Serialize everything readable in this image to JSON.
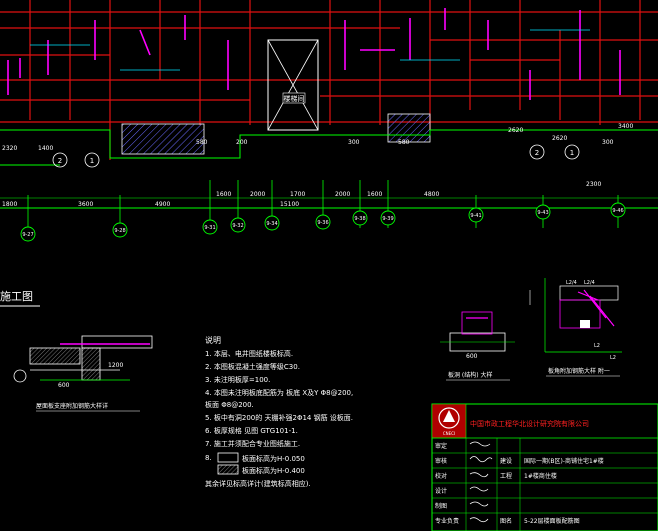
{
  "colors": {
    "background": "#000000",
    "wall": "#e01010",
    "axis": "#00ff00",
    "text": "#ffffff",
    "dim": "#00ff00",
    "rebar": "#ff00ff",
    "cyan": "#00e5ff",
    "hatch": "#4060ff",
    "yellow": "#ffff00"
  },
  "plan": {
    "stair_label": "楼梯间",
    "top_dim_labels": [
      "2320",
      "1400",
      "2620",
      "2620",
      "3400",
      "580",
      "200",
      "300",
      "580",
      "300"
    ],
    "axis_dims": [
      "1800",
      "3600",
      "4900",
      "1600",
      "2000",
      "15100",
      "1700",
      "2000",
      "1600",
      "4800",
      "2300"
    ],
    "axis_bubbles": [
      "9-27",
      "9-28",
      "9-31",
      "9-32",
      "9-34",
      "9-36",
      "9-38",
      "9-39",
      "9-41",
      "9-43",
      "9-46"
    ],
    "section_bubbles": [
      "2",
      "1",
      "2",
      "1"
    ]
  },
  "title_left": "施工图",
  "detail_left": {
    "caption": "屋面板支座附加钢筋大样详",
    "dims": [
      "600",
      "1200"
    ]
  },
  "notes": {
    "heading": "说明",
    "lines": [
      "1. 本层、电井图纸楼板标高.",
      "2. 本图板混凝土强度等级C30.",
      "3. 未注明板厚=100.",
      "4. 本图未注明板底配筋为 板底 X及Y  Φ8@200,",
      "   板面 Φ8@200.",
      "5. 板中有洞200的 天棚补强2Φ14 钢筋 设板面.",
      "6. 板厚规格 见图 GTG101-1.",
      "7. 施工并须配合专业图纸施工."
    ],
    "legend": [
      {
        "index": "8.",
        "label": "板面标高为H-0.050"
      },
      {
        "index": "",
        "label": "板面标高为H-0.400"
      }
    ],
    "footer": "其余详见标高详计(建筑标高相应)."
  },
  "detail_mid": {
    "caption": "板洞 (结构) 大样",
    "dim": "600"
  },
  "detail_right": {
    "labels": [
      "L2/4",
      "L2/4"
    ],
    "bottom": [
      "L2",
      "L2"
    ],
    "caption": "板角附加钢筋大样  附一"
  },
  "title_block": {
    "company": "中国市政工程华北设计研究院有限公司",
    "logo": "CNECI",
    "rows": [
      {
        "c1": "审定",
        "c2": "",
        "c3": "",
        "c4": ""
      },
      {
        "c1": "审核",
        "c2": "",
        "c3": "建设",
        "c4": "国际一期(B区)-商铺住宅1#楼"
      },
      {
        "c1": "校对",
        "c2": "",
        "c3": "",
        "c4": ""
      },
      {
        "c1": "设计",
        "c2": "",
        "c3": "工程",
        "c4": "1#楼商住楼"
      },
      {
        "c1": "制图",
        "c2": "",
        "c3": "",
        "c4": ""
      },
      {
        "c1": "专业负责",
        "c2": "",
        "c3": "图名",
        "c4": "5-22层楼面板配筋图"
      }
    ]
  }
}
